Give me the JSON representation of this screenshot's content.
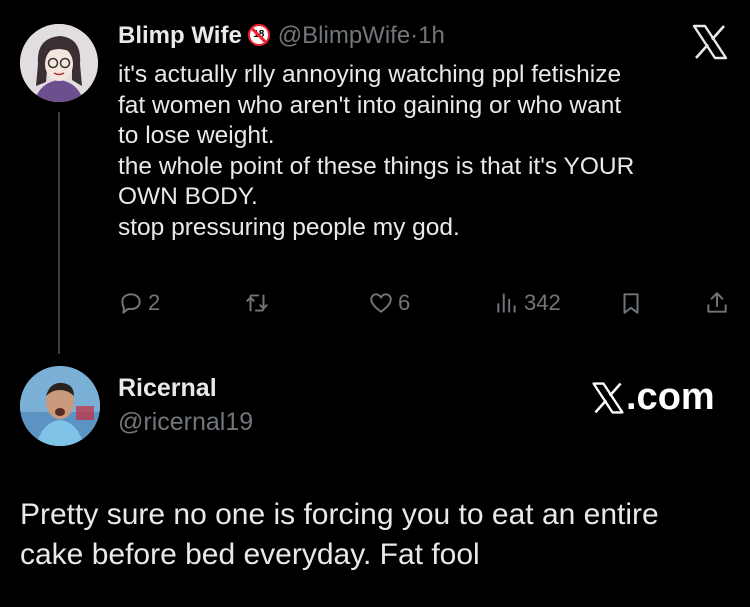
{
  "tweet1": {
    "display_name": "Blimp Wife",
    "badge_text": "18",
    "handle": "@BlimpWife",
    "separator": "·",
    "time": "1h",
    "body_lines": [
      "it's actually rlly annoying watching ppl fetishize",
      "fat women who aren't into gaining or who want",
      "to lose weight.",
      "the whole point of these things is that it's YOUR",
      "OWN BODY.",
      "stop pressuring people my god."
    ],
    "actions": {
      "replies": "2",
      "likes": "6",
      "views": "342"
    }
  },
  "tweet2": {
    "display_name": "Ricernal",
    "handle": "@ricernal19",
    "watermark": ".com",
    "body_lines": [
      "Pretty sure no one is forcing you to eat an entire",
      "cake before bed everyday. Fat fool"
    ]
  },
  "colors": {
    "background": "#000000",
    "text": "#e7e9ea",
    "muted": "#71767b",
    "badge_red": "#f4212e"
  },
  "icons": [
    "x-logo-icon",
    "reply-icon",
    "retweet-icon",
    "like-icon",
    "views-icon",
    "bookmark-icon",
    "share-icon",
    "no-entry-18-icon"
  ]
}
